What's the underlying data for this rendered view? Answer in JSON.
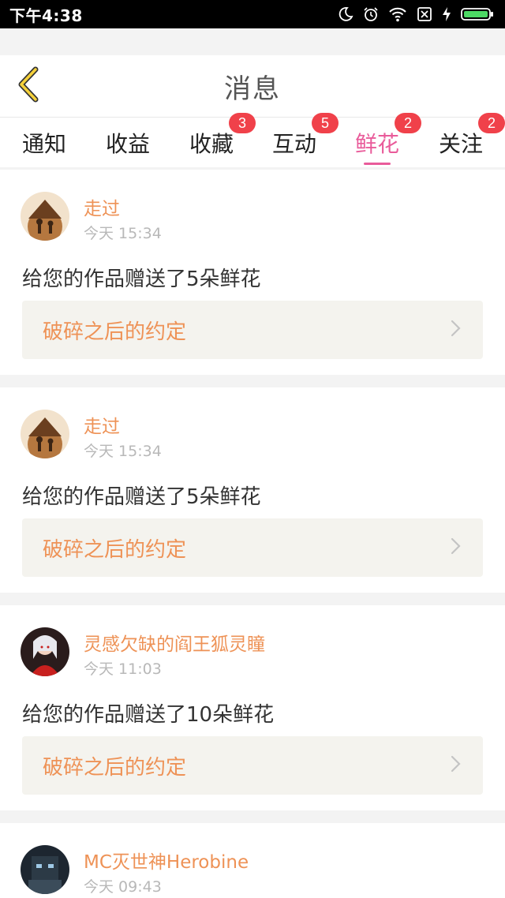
{
  "status_bar": {
    "time": "下午4:38",
    "icons": [
      "moon-icon",
      "alarm-icon",
      "wifi-icon",
      "no-sim-icon",
      "charging-icon",
      "battery-icon"
    ]
  },
  "header": {
    "title": "消息",
    "back_icon": "chevron-left-icon"
  },
  "tabs": [
    {
      "label": "通知",
      "badge": ""
    },
    {
      "label": "收益",
      "badge": ""
    },
    {
      "label": "收藏",
      "badge": "3"
    },
    {
      "label": "互动",
      "badge": "5"
    },
    {
      "label": "鲜花",
      "badge": "2",
      "active": true
    },
    {
      "label": "关注",
      "badge": "2"
    }
  ],
  "colors": {
    "accent_pink": "#e95b9a",
    "accent_orange": "#ee9256",
    "badge_red": "#f0414a"
  },
  "messages": [
    {
      "user": "走过",
      "time": "今天 15:34",
      "text": "给您的作品赠送了5朵鲜花",
      "work": "破碎之后的约定"
    },
    {
      "user": "走过",
      "time": "今天 15:34",
      "text": "给您的作品赠送了5朵鲜花",
      "work": "破碎之后的约定"
    },
    {
      "user": "灵感欠缺的阎王狐灵瞳",
      "time": "今天 11:03",
      "text": "给您的作品赠送了10朵鲜花",
      "work": "破碎之后的约定"
    },
    {
      "user": "MC灭世神Herobine",
      "time": "今天 09:43",
      "text": "",
      "work": ""
    }
  ]
}
